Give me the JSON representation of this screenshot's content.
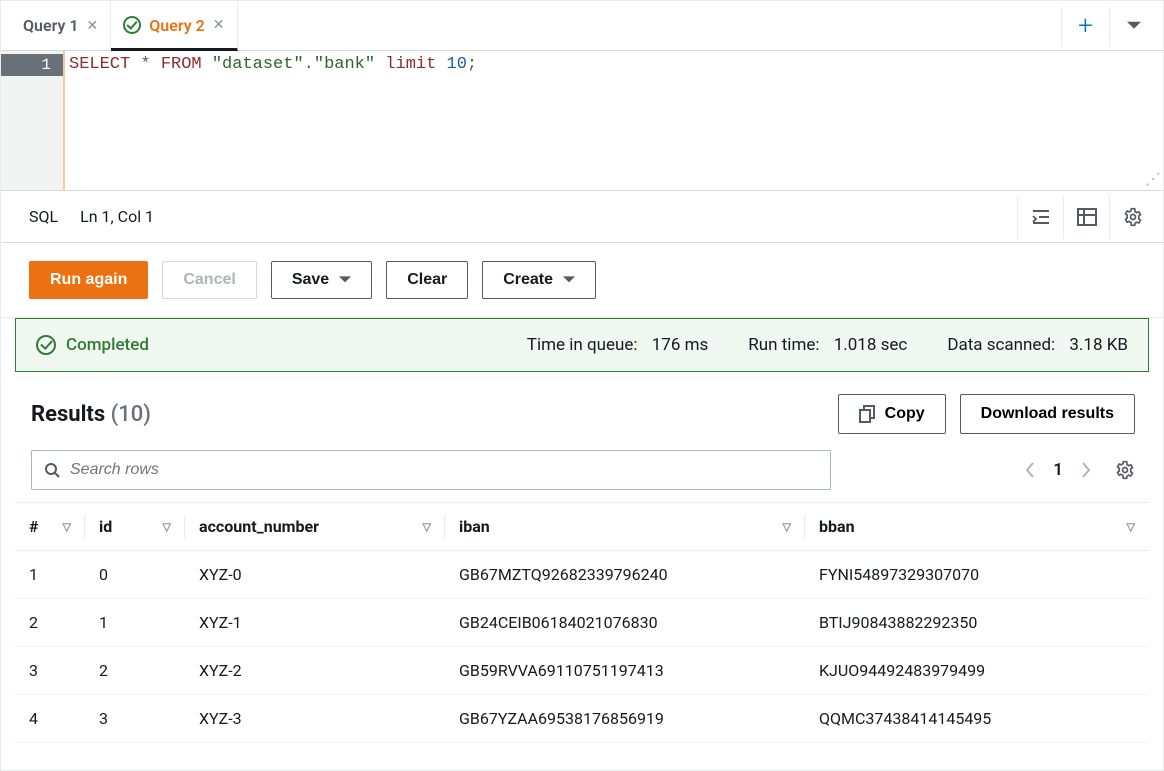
{
  "tabs": {
    "items": [
      {
        "label": "Query 1",
        "has_check": false
      },
      {
        "label": "Query 2",
        "has_check": true
      }
    ],
    "active_index": 1
  },
  "editor": {
    "line_number": "1",
    "sql_tokens": {
      "select": "SELECT",
      "star": "*",
      "from": "FROM",
      "dataset": "\"dataset\"",
      "dot": ".",
      "bank": "\"bank\"",
      "limit": "limit",
      "ten": "10",
      "semi": ";"
    }
  },
  "status": {
    "lang": "SQL",
    "pos": "Ln 1, Col 1"
  },
  "actions": {
    "run": "Run again",
    "cancel": "Cancel",
    "save": "Save",
    "clear": "Clear",
    "create": "Create"
  },
  "banner": {
    "status_label": "Completed",
    "queue_label": "Time in queue:",
    "queue_value": "176 ms",
    "runtime_label": "Run time:",
    "runtime_value": "1.018 sec",
    "scanned_label": "Data scanned:",
    "scanned_value": "3.18 KB"
  },
  "results": {
    "title": "Results",
    "count_display": "(10)",
    "copy_label": "Copy",
    "download_label": "Download results",
    "search_placeholder": "Search rows",
    "page": "1",
    "columns": {
      "idx": "#",
      "id": "id",
      "account_number": "account_number",
      "iban": "iban",
      "bban": "bban"
    },
    "rows": [
      {
        "idx": "1",
        "id": "0",
        "account_number": "XYZ-0",
        "iban": "GB67MZTQ92682339796240",
        "bban": "FYNI54897329307070"
      },
      {
        "idx": "2",
        "id": "1",
        "account_number": "XYZ-1",
        "iban": "GB24CEIB06184021076830",
        "bban": "BTIJ90843882292350"
      },
      {
        "idx": "3",
        "id": "2",
        "account_number": "XYZ-2",
        "iban": "GB59RVVA69110751197413",
        "bban": "KJUO94492483979499"
      },
      {
        "idx": "4",
        "id": "3",
        "account_number": "XYZ-3",
        "iban": "GB67YZAA69538176856919",
        "bban": "QQMC37438414145495"
      }
    ]
  }
}
